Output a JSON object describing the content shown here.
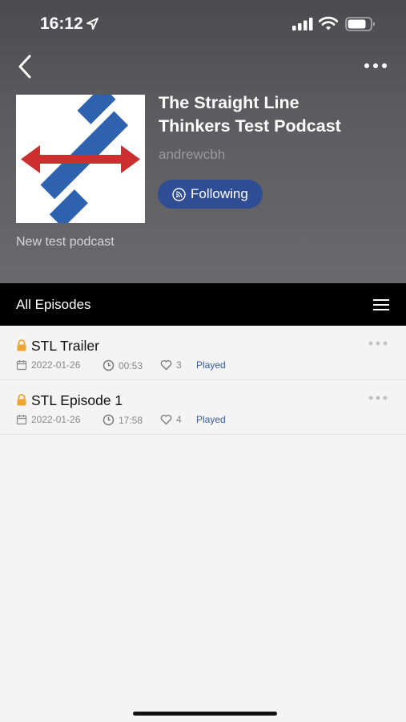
{
  "status_bar": {
    "time": "16:12"
  },
  "podcast": {
    "title_line1": "The Straight Line",
    "title_line2": "Thinkers Test Podcast",
    "author": "andrewcbh",
    "follow_label": "Following",
    "description": "New test podcast"
  },
  "episodes_section": {
    "title": "All Episodes"
  },
  "episodes": [
    {
      "title": "STL Trailer",
      "date": "2022-01-26",
      "duration": "00:53",
      "likes": "3",
      "status": "Played"
    },
    {
      "title": "STL Episode 1",
      "date": "2022-01-26",
      "duration": "17:58",
      "likes": "4",
      "status": "Played"
    }
  ],
  "colors": {
    "header_bg": "#55555a",
    "follow_button": "#2e4d95",
    "lock_icon": "#f0a531",
    "played_text": "#3a5a9c",
    "logo_blue": "#2f62ae",
    "logo_red": "#cc2f2f"
  },
  "icons": [
    "location-arrow-icon",
    "signal-icon",
    "wifi-icon",
    "battery-icon",
    "back-arrow-icon",
    "more-dots-icon",
    "rss-icon",
    "hamburger-menu-icon",
    "lock-icon",
    "calendar-icon",
    "clock-icon",
    "heart-icon"
  ]
}
